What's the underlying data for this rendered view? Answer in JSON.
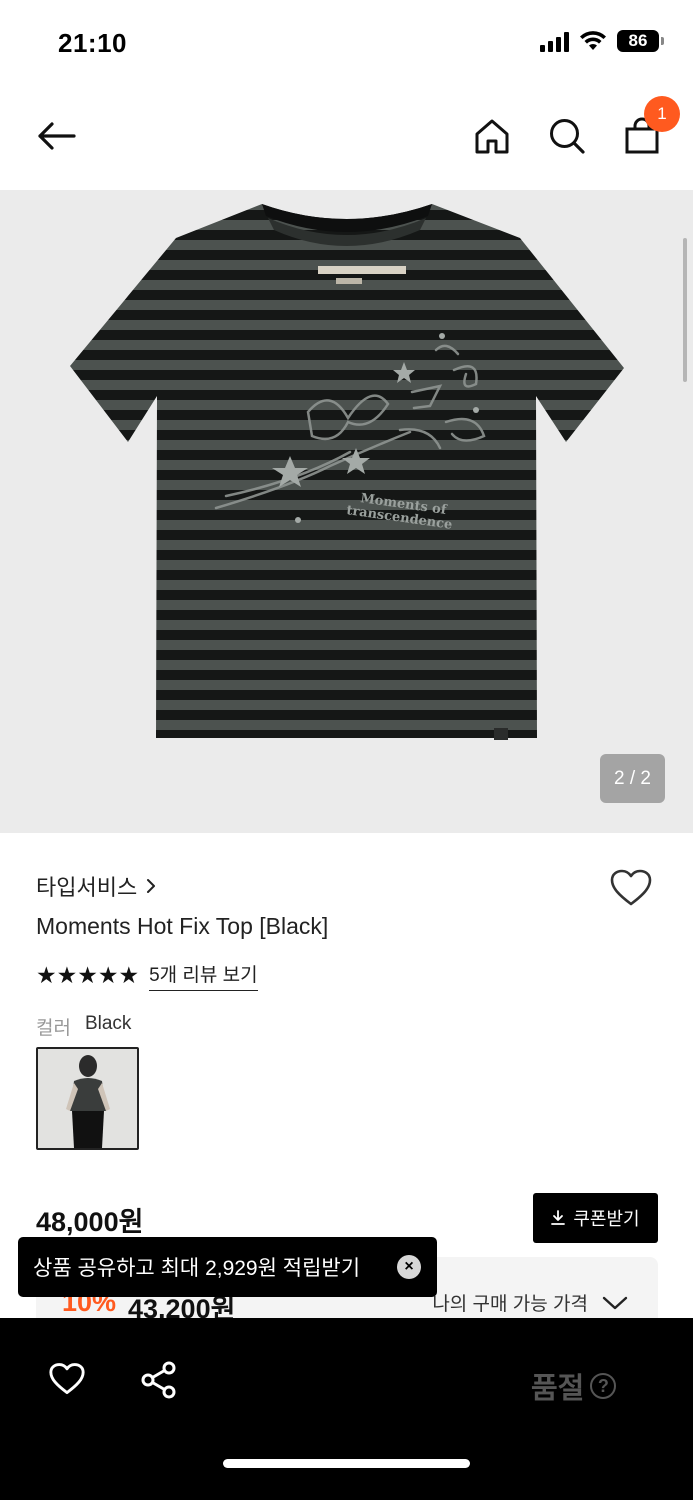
{
  "status": {
    "time": "21:10",
    "battery": "86"
  },
  "nav": {
    "cart_count": "1"
  },
  "image": {
    "counter": "2 / 2"
  },
  "product": {
    "brand": "타입서비스",
    "title": "Moments Hot Fix Top [Black]",
    "stars": "★★★★★",
    "review_link": "5개 리뷰 보기",
    "color_label": "컬러",
    "color_value": "Black",
    "price": "48,000원",
    "coupon_label": "쿠폰받기",
    "discount": "10%",
    "sale_price": "43,200원",
    "my_price_label": "나의 구매 가능 가격"
  },
  "toast": {
    "text": "상품 공유하고 최대 2,929원 적립받기"
  },
  "bottom": {
    "soldout_label": "품절",
    "help": "?"
  },
  "colors": {
    "accent": "#ff5a1f",
    "black": "#000000",
    "bg_image": "#ebebeb"
  }
}
